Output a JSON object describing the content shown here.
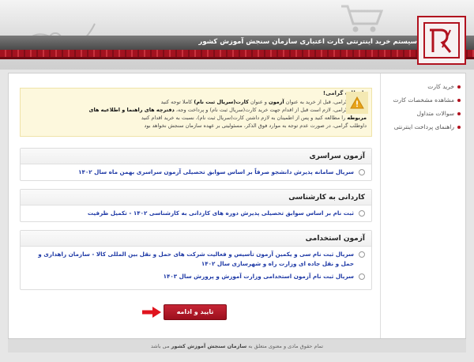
{
  "header": {
    "title": "سیستم خرید اینترنتی کارت اعتباری سازمان سنجش آموزش کشور"
  },
  "sidebar": {
    "items": [
      {
        "label": "خرید کارت"
      },
      {
        "label": "مشاهده مشخصات کارت"
      },
      {
        "label": "سوالات متداول"
      },
      {
        "label": "راهنمای پرداخت اینترنتی"
      }
    ]
  },
  "notice": {
    "title": "داوطلب گرامی!",
    "line1_a": "داوطلب گرامی، قبل از خرید به عنوان",
    "line1_b": "آزمون",
    "line1_c": "و عنوان",
    "line1_d": "کارت(سریال ثبت نام)",
    "line1_e": "کاملا توجه کنید",
    "line2_a": "داوطلب گرامی، لازم است قبل از اقدام جهت خرید کارت(سریال ثبت نام) و پرداخت وجه،",
    "line2_b": "دفترچه های راهنما و اطلاعیه های",
    "line3_a": "مربوطه",
    "line3_b": "را مطالعه کنید و پس از اطمینان به لازم داشتن کارت(سریال ثبت نام)، نسبت به خرید اقدام کنید",
    "line4": "داوطلب گرامی، در صورت عدم توجه به موارد فوق الذکر، مسئولیتی بر عهده سازمان سنجش نخواهد بود"
  },
  "groups": [
    {
      "title": "آزمون سراسری",
      "options": [
        {
          "label": "سریال سامانه پذیرش دانشجو صرفاً بر اساس سوابق تحصیلی آزمون سراسری بهمن ماه سال ۱۴۰۲"
        }
      ]
    },
    {
      "title": "کاردانی به کارشناسی",
      "options": [
        {
          "label": "ثبت نام بر اساس سوابق تحصیلی پذیرش دوره های کاردانی به کارشناسی ۱۴۰۲ - تکمیل ظرفیت"
        }
      ]
    },
    {
      "title": "آزمون استخدامی",
      "options": [
        {
          "label": "سریال ثبت نام سی و یکمین آزمون تأسیس و فعالیت شرکت های حمل و نقل بین المللی کالا - سازمان راهداری و حمل و نقل جاده ای وزارت راه و شهرسازی سال ۱۴۰۲"
        },
        {
          "label": "سریال ثبت نام آزمون استخدامی وزارت آموزش و پرورش سال ۱۴۰۳"
        }
      ]
    }
  ],
  "submit": {
    "label": "تایید و ادامه"
  },
  "footer": {
    "a": "تمام حقوق مادی و معنوی متعلق به",
    "b": "سازمان سنجش آموزش کشور",
    "c": "می باشد"
  },
  "colors": {
    "accent": "#b1121f",
    "link": "#1f3aa6",
    "notice_bg": "#fdf8dd"
  }
}
